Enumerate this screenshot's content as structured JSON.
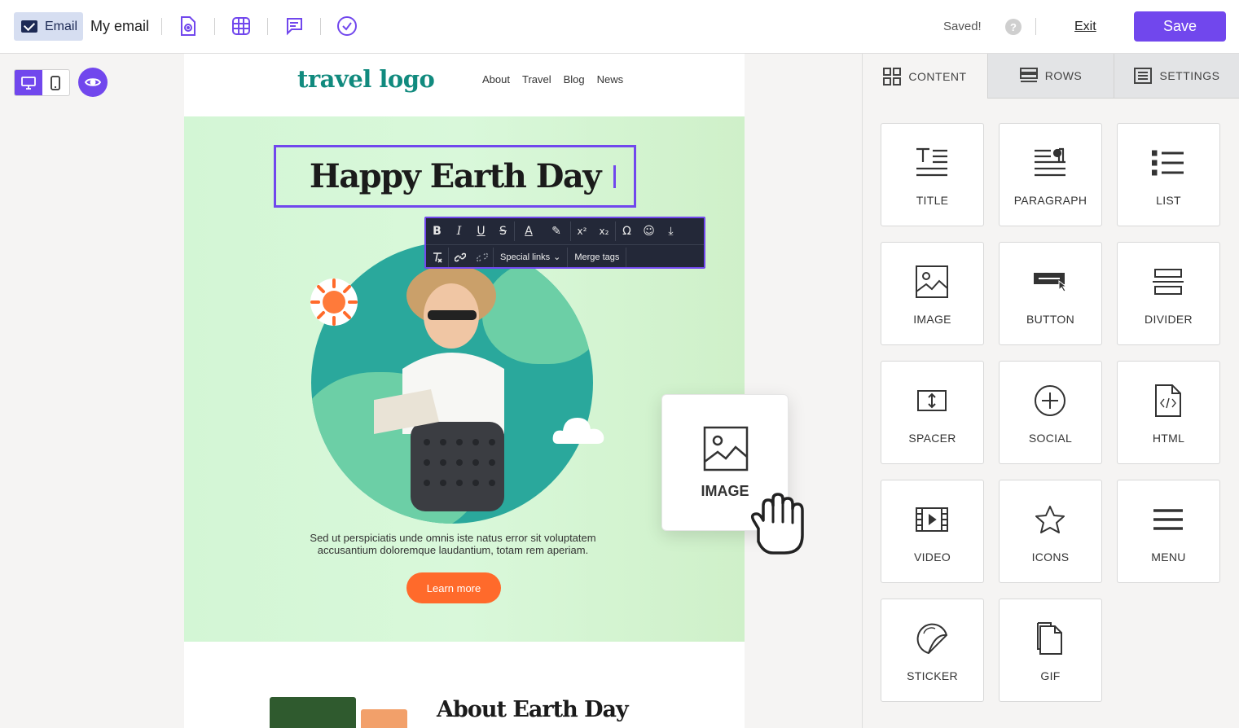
{
  "topbar": {
    "email_chip_label": "Email",
    "document_name": "My email",
    "saved_status": "Saved!",
    "help_glyph": "?",
    "exit_label": "Exit",
    "save_label": "Save",
    "toolbar_icons": [
      "file-settings-icon",
      "grid-icon",
      "comment-icon",
      "check-circle-icon"
    ]
  },
  "view_controls": {
    "modes": [
      "desktop-icon",
      "mobile-icon"
    ],
    "active_mode": "desktop",
    "preview_icon": "eye-icon"
  },
  "email": {
    "logo_text": "travel logo",
    "nav": [
      "About",
      "Travel",
      "Blog",
      "News"
    ],
    "hero_title": "Happy Earth Day",
    "hero_body_line1": "Sed ut perspiciatis unde omnis iste natus error sit voluptatem",
    "hero_body_line2": "accusantium doloremque laudantium, totam rem aperiam.",
    "cta_label": "Learn more",
    "section2_title": "About Earth Day"
  },
  "text_toolbar": {
    "row1": [
      "B",
      "I",
      "U",
      "S",
      "A",
      "✎",
      "x²",
      "x₂",
      "Ω",
      "☺",
      "⤓"
    ],
    "special_links_label": "Special links",
    "merge_tags_label": "Merge tags"
  },
  "drag_ghost": {
    "label": "IMAGE"
  },
  "panel": {
    "tabs": [
      {
        "label": "CONTENT",
        "icon": "grid-icon",
        "active": true
      },
      {
        "label": "ROWS",
        "icon": "rows-icon",
        "active": false
      },
      {
        "label": "SETTINGS",
        "icon": "settings-list-icon",
        "active": false
      }
    ],
    "tiles": [
      {
        "label": "TITLE",
        "icon": "title-icon"
      },
      {
        "label": "PARAGRAPH",
        "icon": "paragraph-icon"
      },
      {
        "label": "LIST",
        "icon": "list-icon"
      },
      {
        "label": "IMAGE",
        "icon": "image-icon"
      },
      {
        "label": "BUTTON",
        "icon": "button-icon"
      },
      {
        "label": "DIVIDER",
        "icon": "divider-icon"
      },
      {
        "label": "SPACER",
        "icon": "spacer-icon"
      },
      {
        "label": "SOCIAL",
        "icon": "social-icon"
      },
      {
        "label": "HTML",
        "icon": "html-icon"
      },
      {
        "label": "VIDEO",
        "icon": "video-icon"
      },
      {
        "label": "ICONS",
        "icon": "star-icon"
      },
      {
        "label": "MENU",
        "icon": "menu-icon"
      },
      {
        "label": "STICKER",
        "icon": "sticker-icon"
      },
      {
        "label": "GIF",
        "icon": "gif-icon"
      }
    ]
  },
  "colors": {
    "accent": "#7147ed",
    "brand_teal": "#118a7e",
    "cta_orange": "#ff6a2b",
    "hero_bg": "#d6f7d7"
  }
}
